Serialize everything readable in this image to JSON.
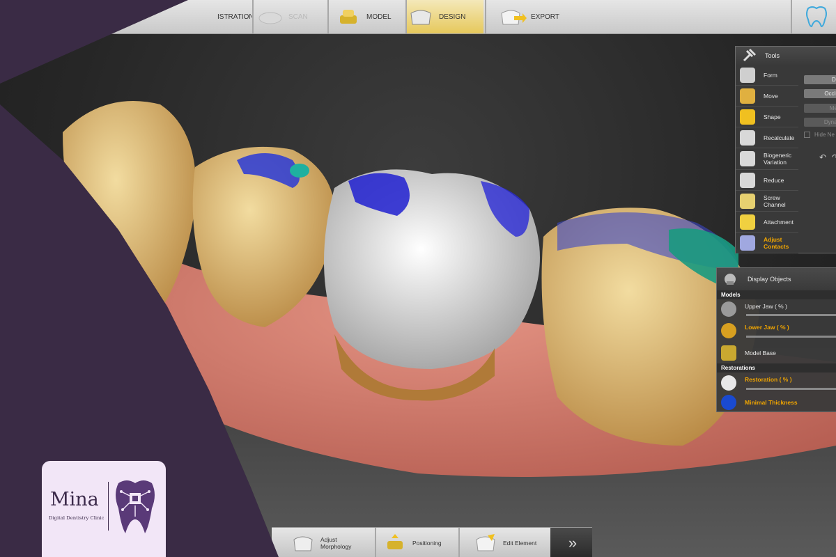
{
  "workflow": {
    "steps": [
      {
        "label": "ISTRATION"
      },
      {
        "label": "SCAN"
      },
      {
        "label": "MODEL"
      },
      {
        "label": "DESIGN"
      },
      {
        "label": "EXPORT"
      }
    ]
  },
  "tools_panel": {
    "title": "Tools",
    "items": [
      {
        "label": "Form"
      },
      {
        "label": "Move"
      },
      {
        "label": "Shape"
      },
      {
        "label": "Recalculate"
      },
      {
        "label": "Biogeneric Variation"
      },
      {
        "label": "Reduce"
      },
      {
        "label": "Screw Channel"
      },
      {
        "label": "Attachment"
      },
      {
        "label": "Adjust Contacts"
      }
    ],
    "options": [
      "Distal",
      "Occlusal",
      "Mesial",
      "Dynamic"
    ],
    "hide_checkbox": "Hide Ne"
  },
  "display_panel": {
    "title": "Display Objects",
    "models_header": "Models",
    "upper_jaw": "Upper Jaw ( % )",
    "lower_jaw": "Lower Jaw ( % )",
    "model_base": "Model Base",
    "restorations_header": "Restorations",
    "restoration": "Restoration ( % )",
    "minimal_thickness": "Minimal Thickness"
  },
  "bottom_bar": {
    "steps": [
      {
        "label": "Adjust Morphology"
      },
      {
        "label": "Positioning"
      },
      {
        "label": "Edit Element"
      }
    ],
    "next_label": "»"
  },
  "brand": {
    "name": "Mina",
    "subtitle": "Digital Dentistry Clinic"
  },
  "colors": {
    "background_purple": "#3a2b45",
    "accent_orange": "#f0a500",
    "active_step": "#e6c85b",
    "brand_card": "#f2e6f7"
  }
}
